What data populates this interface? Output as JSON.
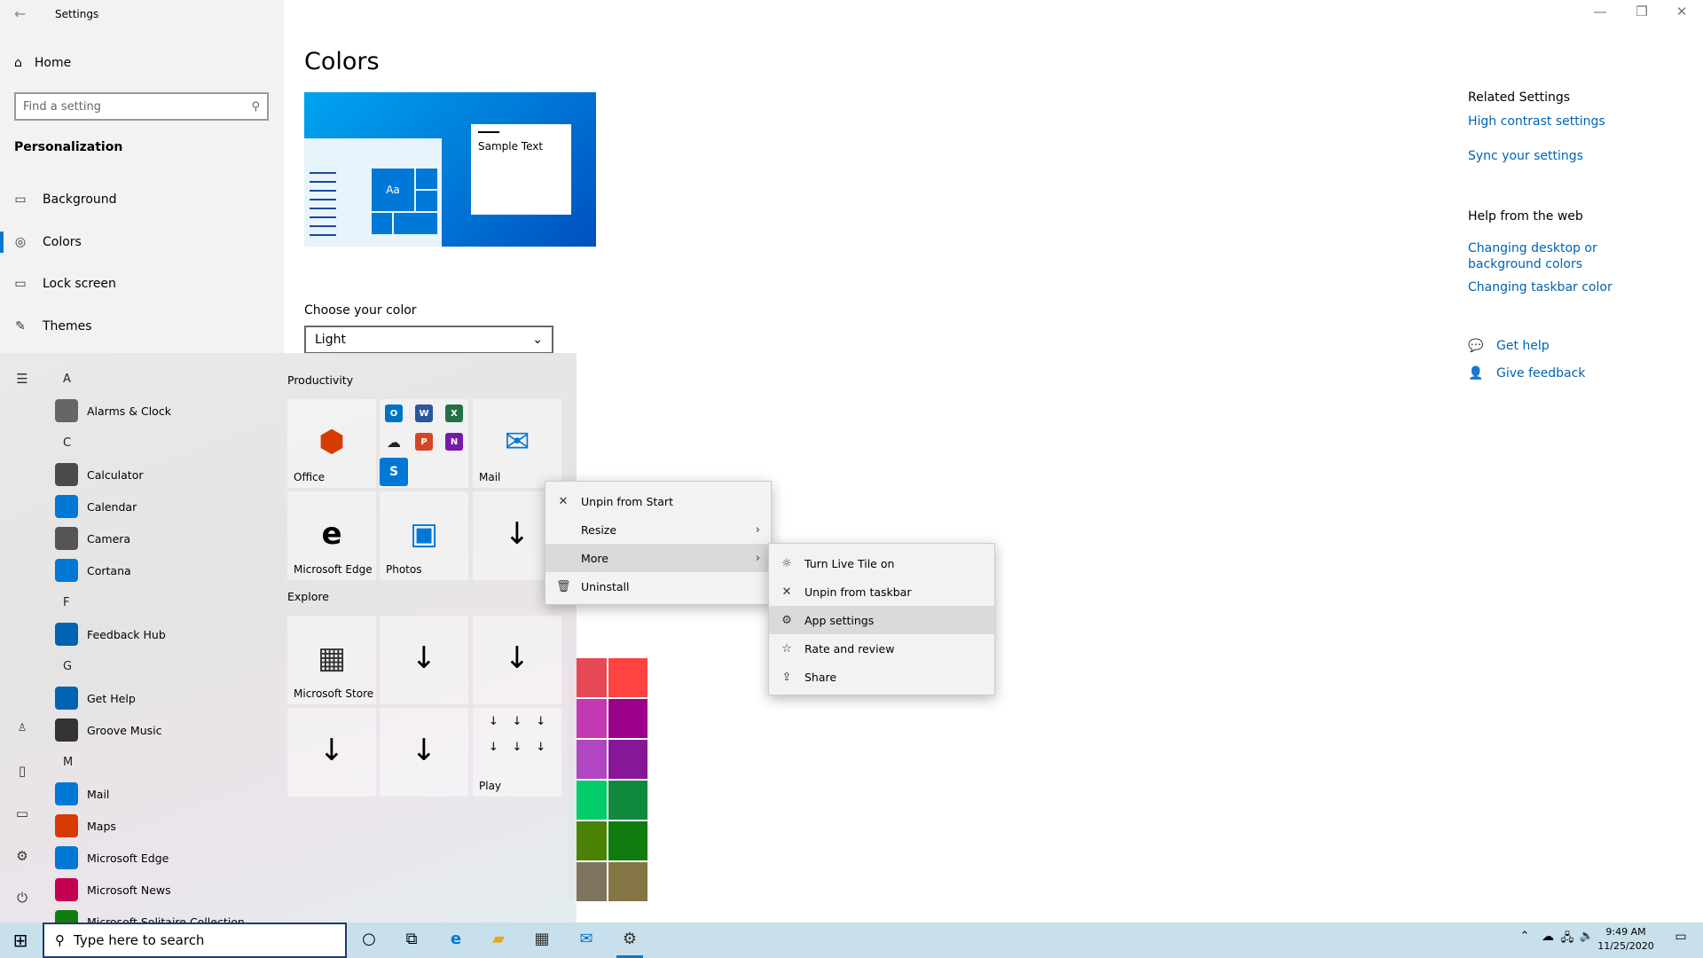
{
  "window": {
    "title": "Settings",
    "controls": [
      "—",
      "❐",
      "✕"
    ]
  },
  "nav": {
    "home": "Home",
    "search_placeholder": "Find a setting",
    "section": "Personalization",
    "items": [
      {
        "label": "Background",
        "icon": "picture-icon"
      },
      {
        "label": "Colors",
        "icon": "palette-icon",
        "selected": true
      },
      {
        "label": "Lock screen",
        "icon": "lock-screen-icon"
      },
      {
        "label": "Themes",
        "icon": "brush-icon"
      }
    ]
  },
  "main": {
    "title": "Colors",
    "sample_text": "Sample Text",
    "preview_tile_text": "Aa",
    "choose_label": "Choose your color",
    "choose_value": "Light",
    "swatches": [
      "#e74856",
      "#ff4343",
      "#c239b3",
      "#9a0089",
      "#b146c2",
      "#881798",
      "#00cc6a",
      "#10893e",
      "#498205",
      "#107c10",
      "#7e735f",
      "#847545"
    ]
  },
  "related": {
    "heading": "Related Settings",
    "links": [
      "High contrast settings",
      "Sync your settings"
    ],
    "help_heading": "Help from the web",
    "help_links": [
      "Changing desktop or background colors",
      "Changing taskbar color"
    ],
    "get_help": "Get help",
    "give_feedback": "Give feedback"
  },
  "start": {
    "letters": [
      "A",
      "C",
      "F",
      "G",
      "M"
    ],
    "apps": [
      {
        "label": "Alarms & Clock",
        "color": "#666"
      },
      {
        "label": "Calculator",
        "color": "#4a4a4a"
      },
      {
        "label": "Calendar",
        "color": "#0078d7"
      },
      {
        "label": "Camera",
        "color": "#555"
      },
      {
        "label": "Cortana",
        "color": "#0078d7"
      },
      {
        "label": "Feedback Hub",
        "color": "#0063b1"
      },
      {
        "label": "Get Help",
        "color": "#0063b1"
      },
      {
        "label": "Groove Music",
        "color": "#333"
      },
      {
        "label": "Mail",
        "color": "#0078d7"
      },
      {
        "label": "Maps",
        "color": "#d83b01"
      },
      {
        "label": "Microsoft Edge",
        "color": "#0078d7"
      },
      {
        "label": "Microsoft News",
        "color": "#c30052"
      },
      {
        "label": "Microsoft Solitaire Collection",
        "color": "#107c10"
      }
    ],
    "groups": {
      "productivity": "Productivity",
      "explore": "Explore"
    },
    "tiles": {
      "office": "Office",
      "mail": "Mail",
      "edge": "Microsoft Edge",
      "photos": "Photos",
      "store": "Microsoft Store",
      "play": "Play"
    }
  },
  "context_menu": {
    "items": [
      {
        "label": "Unpin from Start",
        "icon": "unpin-icon"
      },
      {
        "label": "Resize",
        "icon": "",
        "submenu": true
      },
      {
        "label": "More",
        "icon": "",
        "submenu": true,
        "highlighted": true
      },
      {
        "label": "Uninstall",
        "icon": "trash-icon"
      }
    ]
  },
  "submenu": {
    "items": [
      {
        "label": "Turn Live Tile on",
        "icon": "live-tile-icon"
      },
      {
        "label": "Unpin from taskbar",
        "icon": "unpin-icon"
      },
      {
        "label": "App settings",
        "icon": "gear-icon",
        "highlighted": true
      },
      {
        "label": "Rate and review",
        "icon": "star-icon"
      },
      {
        "label": "Share",
        "icon": "share-icon"
      }
    ]
  },
  "taskbar": {
    "search_placeholder": "Type here to search",
    "time": "9:49 AM",
    "date": "11/25/2020"
  }
}
